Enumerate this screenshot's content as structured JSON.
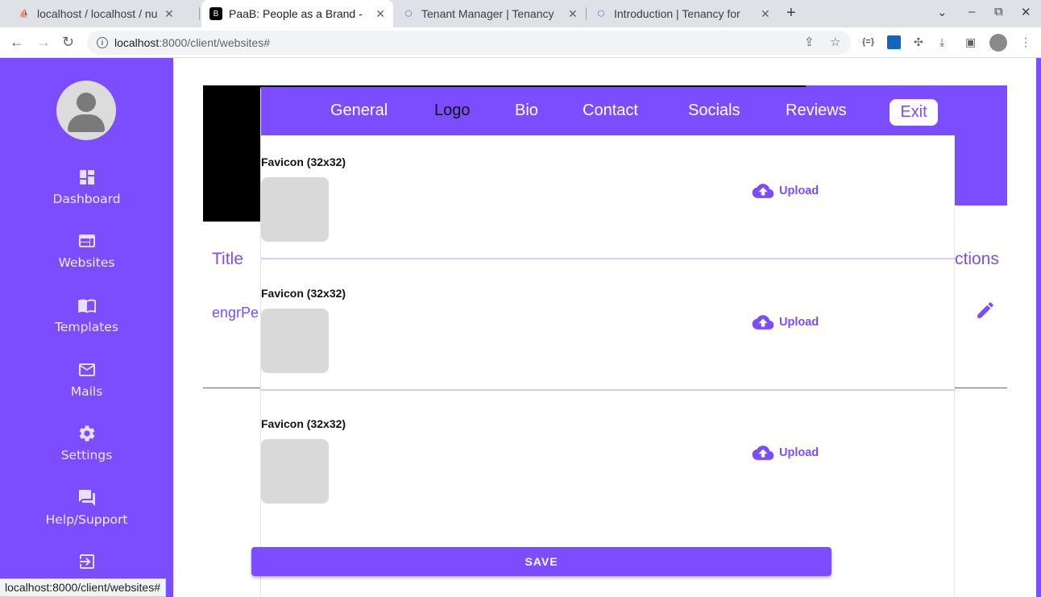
{
  "browser": {
    "tabs": [
      {
        "title": "localhost / localhost / nup",
        "active": false
      },
      {
        "title": "PaaB: People as a Brand -",
        "active": true
      },
      {
        "title": "Tenant Manager | Tenancy",
        "active": false
      },
      {
        "title": "Introduction | Tenancy for",
        "active": false
      }
    ],
    "url_host": "localhost",
    "url_path": ":8000/client/websites#",
    "status_url": "localhost:8000/client/websites#"
  },
  "sidebar": {
    "items": [
      {
        "label": "Dashboard",
        "icon": "dashboard-icon"
      },
      {
        "label": "Websites",
        "icon": "web-icon"
      },
      {
        "label": "Templates",
        "icon": "template-icon"
      },
      {
        "label": "Mails",
        "icon": "mail-icon"
      },
      {
        "label": "Settings",
        "icon": "gear-icon"
      },
      {
        "label": "Help/Support",
        "icon": "chat-icon"
      },
      {
        "label": "",
        "icon": "logout-icon"
      }
    ]
  },
  "background": {
    "title_header": "Title",
    "actions_header": "ctions",
    "row_text": "engrPe"
  },
  "modal": {
    "tabs": [
      "General",
      "Logo",
      "Bio",
      "Contact",
      "Socials",
      "Reviews"
    ],
    "active_tab": "Logo",
    "exit_label": "Exit",
    "sections": [
      {
        "label": "Favicon (32x32)",
        "upload_label": "Upload"
      },
      {
        "label": "Favicon (32x32)",
        "upload_label": "Upload"
      },
      {
        "label": "Favicon (32x32)",
        "upload_label": "Upload"
      }
    ],
    "save_label": "SAVE"
  },
  "colors": {
    "accent": "#7c4dff",
    "placeholder": "#d9d9d9"
  }
}
